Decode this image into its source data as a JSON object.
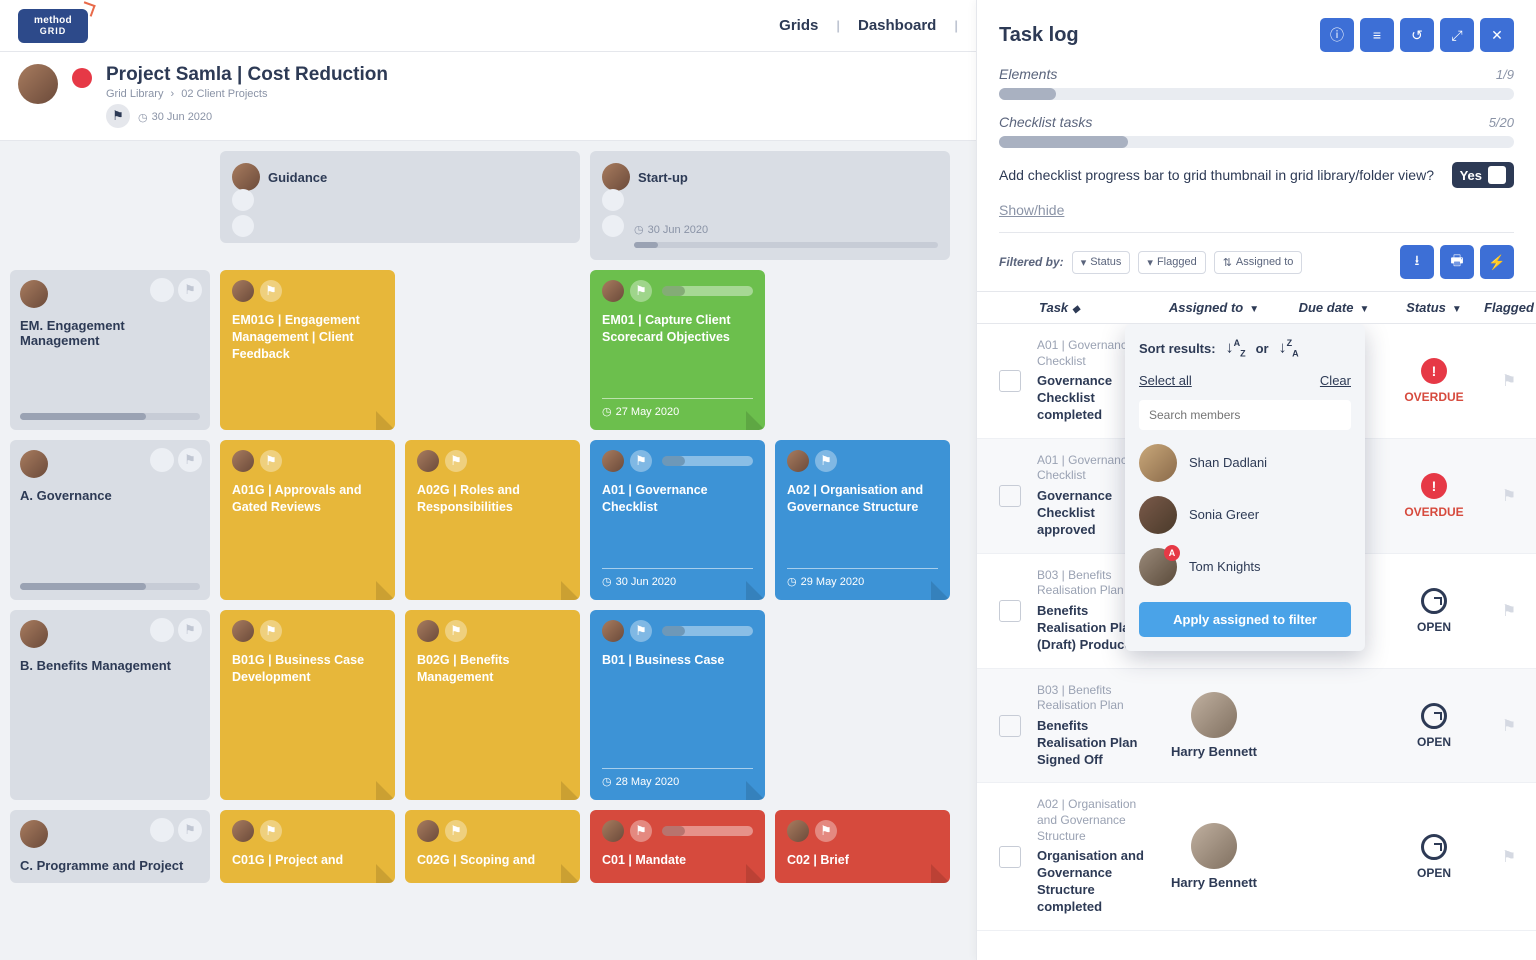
{
  "nav": {
    "logo1": "method",
    "logo2": "GRID",
    "grids": "Grids",
    "dashboard": "Dashboard"
  },
  "project": {
    "title": "Project Samla | Cost Reduction",
    "crumb1": "Grid Library",
    "crumb2": "02 Client Projects",
    "date": "30 Jun 2020"
  },
  "colHeaders": {
    "guidance": "Guidance",
    "startup": "Start-up",
    "startupDate": "30 Jun 2020"
  },
  "rows": {
    "em": {
      "title": "EM. Engagement Management"
    },
    "a": {
      "title": "A. Governance"
    },
    "b": {
      "title": "B. Benefits Management"
    },
    "c": {
      "title": "C. Programme and Project"
    }
  },
  "cards": {
    "em01g": "EM01G | Engagement Management | Client Feedback",
    "em01": {
      "t": "EM01 | Capture Client Scorecard Objectives",
      "d": "27 May 2020"
    },
    "a01g": "A01G | Approvals and Gated Reviews",
    "a02g": "A02G | Roles and Responsibilities",
    "a01": {
      "t": "A01 | Governance Checklist",
      "d": "30 Jun 2020"
    },
    "a02": {
      "t": "A02 | Organisation and Governance Structure",
      "d": "29 May 2020"
    },
    "b01g": "B01G | Business Case Development",
    "b02g": "B02G | Benefits Management",
    "b01": {
      "t": "B01 | Business Case",
      "d": "28 May 2020"
    },
    "c01g": "C01G | Project and",
    "c02g": "C02G | Scoping and",
    "c01": "C01 | Mandate",
    "c02": "C02 | Brief"
  },
  "tasklog": {
    "title": "Task log",
    "elements": {
      "label": "Elements",
      "val": "1/9",
      "pct": 11
    },
    "checklist": {
      "label": "Checklist tasks",
      "val": "5/20",
      "pct": 25
    },
    "question": "Add checklist progress bar to grid thumbnail in grid library/folder view?",
    "toggle": "Yes",
    "showhide": "Show/hide",
    "filteredBy": "Filtered by:",
    "chips": {
      "status": "Status",
      "flagged": "Flagged",
      "assigned": "Assigned to"
    },
    "cols": {
      "task": "Task",
      "assigned": "Assigned to",
      "due": "Due date",
      "status": "Status",
      "flag": "Flagged"
    }
  },
  "tasks": [
    {
      "ref": "A01 | Governance Checklist",
      "title": "Governance Checklist completed",
      "status": "OVERDUE",
      "assignee": "",
      "alt": false
    },
    {
      "ref": "A01 | Governance Checklist",
      "title": "Governance Checklist approved",
      "status": "OVERDUE",
      "assignee": "",
      "alt": true
    },
    {
      "ref": "B03 | Benefits Realisation Plan",
      "title": "Benefits Realisation Plan (Draft) Produced",
      "status": "OPEN",
      "assignee": "",
      "alt": false
    },
    {
      "ref": "B03 | Benefits Realisation Plan",
      "title": "Benefits Realisation Plan Signed Off",
      "status": "OPEN",
      "assignee": "Harry Bennett",
      "alt": true
    },
    {
      "ref": "A02 | Organisation and Governance Structure",
      "title": "Organisation and Governance Structure completed",
      "status": "OPEN",
      "assignee": "Harry Bennett",
      "alt": false
    }
  ],
  "popover": {
    "sortLabel": "Sort results:",
    "or": "or",
    "selectAll": "Select all",
    "clear": "Clear",
    "searchPh": "Search members",
    "members": [
      "Shan Dadlani",
      "Sonia Greer",
      "Tom Knights"
    ],
    "apply": "Apply assigned to filter"
  }
}
